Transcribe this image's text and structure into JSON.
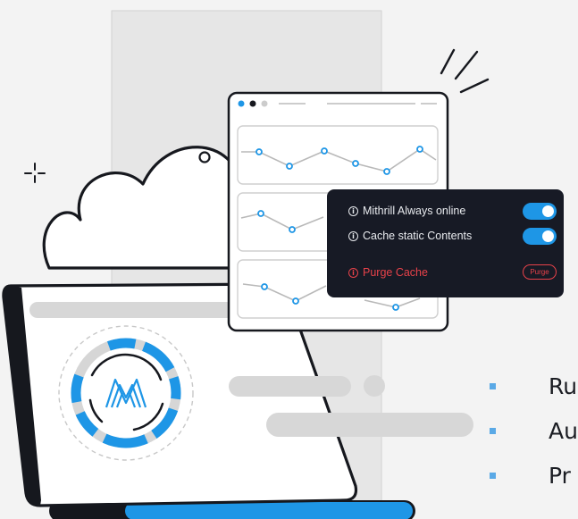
{
  "panel": {
    "rows": [
      {
        "label": "Mithrill Always online",
        "on": true
      },
      {
        "label": "Cache static Contents",
        "on": true
      }
    ],
    "purge": {
      "label": "Purge Cache",
      "button": "Purge"
    }
  },
  "bullets": [
    "Ru",
    "Au",
    "Pr"
  ],
  "colors": {
    "accent": "#1e96e6",
    "danger": "#e8424a",
    "panel_bg": "#171a25",
    "bullet": "#5aa9e6"
  },
  "icons": [
    "info-icon",
    "mithrill-logo",
    "sparkle-icon",
    "toggle-switch"
  ]
}
